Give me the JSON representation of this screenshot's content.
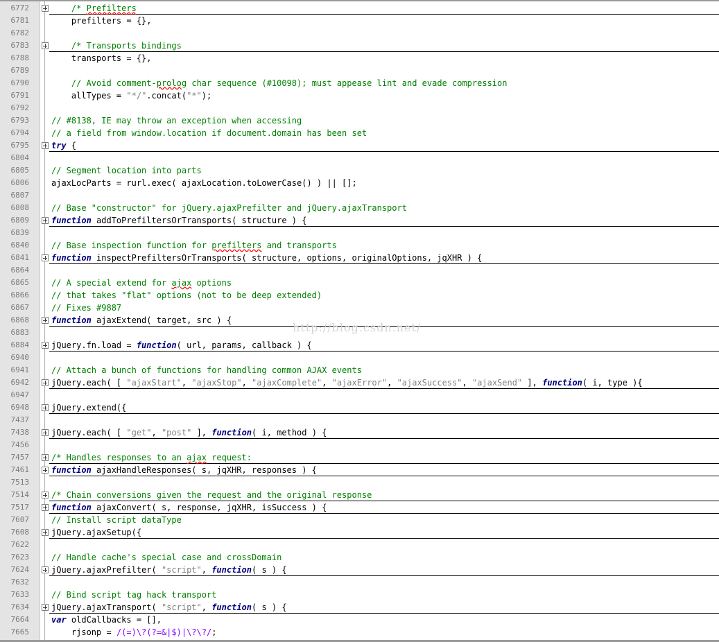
{
  "colors": {
    "comment": "#008000",
    "keyword": "#000080",
    "string": "#808080",
    "regex": "#8000ff",
    "text": "#000000",
    "gutter": "#e4e4e4",
    "line_number": "#7a7a7a"
  },
  "watermark": "http://blog.csdn.net/",
  "lines": [
    {
      "n": "6772",
      "fold": true,
      "indent": "    ",
      "segs": [
        [
          "cm",
          "/* "
        ],
        [
          "cm w",
          "Prefilters"
        ]
      ]
    },
    {
      "n": "6781",
      "fold": false,
      "indent": "    ",
      "segs": [
        [
          "tx",
          "prefilters = {},"
        ]
      ]
    },
    {
      "n": "6782",
      "fold": false,
      "indent": "",
      "segs": []
    },
    {
      "n": "6783",
      "fold": true,
      "indent": "    ",
      "segs": [
        [
          "cm",
          "/* Transports bindings"
        ]
      ]
    },
    {
      "n": "6788",
      "fold": false,
      "indent": "    ",
      "segs": [
        [
          "tx",
          "transports = {},"
        ]
      ]
    },
    {
      "n": "6789",
      "fold": false,
      "indent": "",
      "segs": []
    },
    {
      "n": "6790",
      "fold": false,
      "indent": "    ",
      "segs": [
        [
          "cm",
          "// Avoid comment-"
        ],
        [
          "cm w",
          "prolog"
        ],
        [
          "cm",
          " char sequence (#10098); must appease lint and evade compression"
        ]
      ]
    },
    {
      "n": "6791",
      "fold": false,
      "indent": "    ",
      "segs": [
        [
          "tx",
          "allTypes = "
        ],
        [
          "str",
          "\"*/\""
        ],
        [
          "tx",
          ".concat("
        ],
        [
          "str",
          "\"*\""
        ],
        [
          "tx",
          ");"
        ]
      ]
    },
    {
      "n": "6792",
      "fold": false,
      "indent": "",
      "segs": []
    },
    {
      "n": "6793",
      "fold": false,
      "indent": "",
      "segs": [
        [
          "cm",
          "// #8138, IE may throw an exception when accessing"
        ]
      ]
    },
    {
      "n": "6794",
      "fold": false,
      "indent": "",
      "segs": [
        [
          "cm",
          "// a field from window.location if document.domain has been set"
        ]
      ]
    },
    {
      "n": "6795",
      "fold": true,
      "indent": "",
      "segs": [
        [
          "kw",
          "try"
        ],
        [
          "tx",
          " {"
        ]
      ]
    },
    {
      "n": "6804",
      "fold": false,
      "indent": "",
      "segs": []
    },
    {
      "n": "6805",
      "fold": false,
      "indent": "",
      "segs": [
        [
          "cm",
          "// Segment location into parts"
        ]
      ]
    },
    {
      "n": "6806",
      "fold": false,
      "indent": "",
      "segs": [
        [
          "tx",
          "ajaxLocParts = rurl.exec( ajaxLocation.toLowerCase() ) || [];"
        ]
      ]
    },
    {
      "n": "6807",
      "fold": false,
      "indent": "",
      "segs": []
    },
    {
      "n": "6808",
      "fold": false,
      "indent": "",
      "segs": [
        [
          "cm",
          "// Base \"constructor\" for jQuery.ajaxPrefilter and jQuery.ajaxTransport"
        ]
      ]
    },
    {
      "n": "6809",
      "fold": true,
      "indent": "",
      "segs": [
        [
          "kw",
          "function"
        ],
        [
          "tx",
          " addToPrefiltersOrTransports( structure ) {"
        ]
      ]
    },
    {
      "n": "6839",
      "fold": false,
      "indent": "",
      "segs": []
    },
    {
      "n": "6840",
      "fold": false,
      "indent": "",
      "segs": [
        [
          "cm",
          "// Base inspection function for "
        ],
        [
          "cm w",
          "prefilters"
        ],
        [
          "cm",
          " and transports"
        ]
      ]
    },
    {
      "n": "6841",
      "fold": true,
      "indent": "",
      "segs": [
        [
          "kw",
          "function"
        ],
        [
          "tx",
          " inspectPrefiltersOrTransports( structure, options, originalOptions, jqXHR ) {"
        ]
      ]
    },
    {
      "n": "6864",
      "fold": false,
      "indent": "",
      "segs": []
    },
    {
      "n": "6865",
      "fold": false,
      "indent": "",
      "segs": [
        [
          "cm",
          "// A special extend for "
        ],
        [
          "cm w",
          "ajax"
        ],
        [
          "cm",
          " options"
        ]
      ]
    },
    {
      "n": "6866",
      "fold": false,
      "indent": "",
      "segs": [
        [
          "cm",
          "// that takes \"flat\" options (not to be deep extended)"
        ]
      ]
    },
    {
      "n": "6867",
      "fold": false,
      "indent": "",
      "segs": [
        [
          "cm",
          "// Fixes #9887"
        ]
      ]
    },
    {
      "n": "6868",
      "fold": true,
      "indent": "",
      "segs": [
        [
          "kw",
          "function"
        ],
        [
          "tx",
          " ajaxExtend( target, src ) {"
        ]
      ]
    },
    {
      "n": "6883",
      "fold": false,
      "indent": "",
      "segs": []
    },
    {
      "n": "6884",
      "fold": true,
      "indent": "",
      "segs": [
        [
          "tx",
          "jQuery.fn.load = "
        ],
        [
          "kw",
          "function"
        ],
        [
          "tx",
          "( url, params, callback ) {"
        ]
      ]
    },
    {
      "n": "6940",
      "fold": false,
      "indent": "",
      "segs": []
    },
    {
      "n": "6941",
      "fold": false,
      "indent": "",
      "segs": [
        [
          "cm",
          "// Attach a bunch of functions for handling common AJAX events"
        ]
      ]
    },
    {
      "n": "6942",
      "fold": true,
      "indent": "",
      "segs": [
        [
          "tx",
          "jQuery.each( [ "
        ],
        [
          "str",
          "\"ajaxStart\""
        ],
        [
          "tx",
          ", "
        ],
        [
          "str",
          "\"ajaxStop\""
        ],
        [
          "tx",
          ", "
        ],
        [
          "str",
          "\"ajaxComplete\""
        ],
        [
          "tx",
          ", "
        ],
        [
          "str",
          "\"ajaxError\""
        ],
        [
          "tx",
          ", "
        ],
        [
          "str",
          "\"ajaxSuccess\""
        ],
        [
          "tx",
          ", "
        ],
        [
          "str",
          "\"ajaxSend\""
        ],
        [
          "tx",
          " ], "
        ],
        [
          "kw",
          "function"
        ],
        [
          "tx",
          "( i, type ){"
        ]
      ]
    },
    {
      "n": "6947",
      "fold": false,
      "indent": "",
      "segs": []
    },
    {
      "n": "6948",
      "fold": true,
      "indent": "",
      "segs": [
        [
          "tx",
          "jQuery.extend({"
        ]
      ]
    },
    {
      "n": "7437",
      "fold": false,
      "indent": "",
      "segs": []
    },
    {
      "n": "7438",
      "fold": true,
      "indent": "",
      "segs": [
        [
          "tx",
          "jQuery.each( [ "
        ],
        [
          "str",
          "\"get\""
        ],
        [
          "tx",
          ", "
        ],
        [
          "str",
          "\"post\""
        ],
        [
          "tx",
          " ], "
        ],
        [
          "kw",
          "function"
        ],
        [
          "tx",
          "( i, method ) {"
        ]
      ]
    },
    {
      "n": "7456",
      "fold": false,
      "indent": "",
      "segs": []
    },
    {
      "n": "7457",
      "fold": true,
      "indent": "",
      "segs": [
        [
          "cm",
          "/* Handles responses to an "
        ],
        [
          "cm w",
          "ajax"
        ],
        [
          "cm",
          " request:"
        ]
      ]
    },
    {
      "n": "7461",
      "fold": true,
      "indent": "",
      "segs": [
        [
          "kw",
          "function"
        ],
        [
          "tx",
          " ajaxHandleResponses( s, jqXHR, responses ) {"
        ]
      ]
    },
    {
      "n": "7513",
      "fold": false,
      "indent": "",
      "segs": []
    },
    {
      "n": "7514",
      "fold": true,
      "indent": "",
      "segs": [
        [
          "cm",
          "/* Chain conversions given the request and the original response"
        ]
      ]
    },
    {
      "n": "7517",
      "fold": true,
      "indent": "",
      "segs": [
        [
          "kw",
          "function"
        ],
        [
          "tx",
          " ajaxConvert( s, response, jqXHR, isSuccess ) {"
        ]
      ]
    },
    {
      "n": "7607",
      "fold": false,
      "indent": "",
      "segs": [
        [
          "cm",
          "// Install script dataType"
        ]
      ]
    },
    {
      "n": "7608",
      "fold": true,
      "indent": "",
      "segs": [
        [
          "tx",
          "jQuery.ajaxSetup({"
        ]
      ]
    },
    {
      "n": "7622",
      "fold": false,
      "indent": "",
      "segs": []
    },
    {
      "n": "7623",
      "fold": false,
      "indent": "",
      "segs": [
        [
          "cm",
          "// Handle cache's special case and crossDomain"
        ]
      ]
    },
    {
      "n": "7624",
      "fold": true,
      "indent": "",
      "segs": [
        [
          "tx",
          "jQuery.ajaxPrefilter( "
        ],
        [
          "str",
          "\"script\""
        ],
        [
          "tx",
          ", "
        ],
        [
          "kw",
          "function"
        ],
        [
          "tx",
          "( s ) {"
        ]
      ]
    },
    {
      "n": "7632",
      "fold": false,
      "indent": "",
      "segs": []
    },
    {
      "n": "7633",
      "fold": false,
      "indent": "",
      "segs": [
        [
          "cm",
          "// Bind script tag hack transport"
        ]
      ]
    },
    {
      "n": "7634",
      "fold": true,
      "indent": "",
      "segs": [
        [
          "tx",
          "jQuery.ajaxTransport( "
        ],
        [
          "str",
          "\"script\""
        ],
        [
          "tx",
          ", "
        ],
        [
          "kw",
          "function"
        ],
        [
          "tx",
          "( s ) {"
        ]
      ]
    },
    {
      "n": "7664",
      "fold": false,
      "indent": "",
      "segs": [
        [
          "kw",
          "var"
        ],
        [
          "tx",
          " oldCallbacks = [],"
        ]
      ]
    },
    {
      "n": "7665",
      "fold": false,
      "indent": "    ",
      "segs": [
        [
          "tx",
          "rjsonp = "
        ],
        [
          "rx",
          "/(=)\\?(?=&|$)|\\?\\?/"
        ],
        [
          "tx",
          ";"
        ]
      ]
    }
  ]
}
